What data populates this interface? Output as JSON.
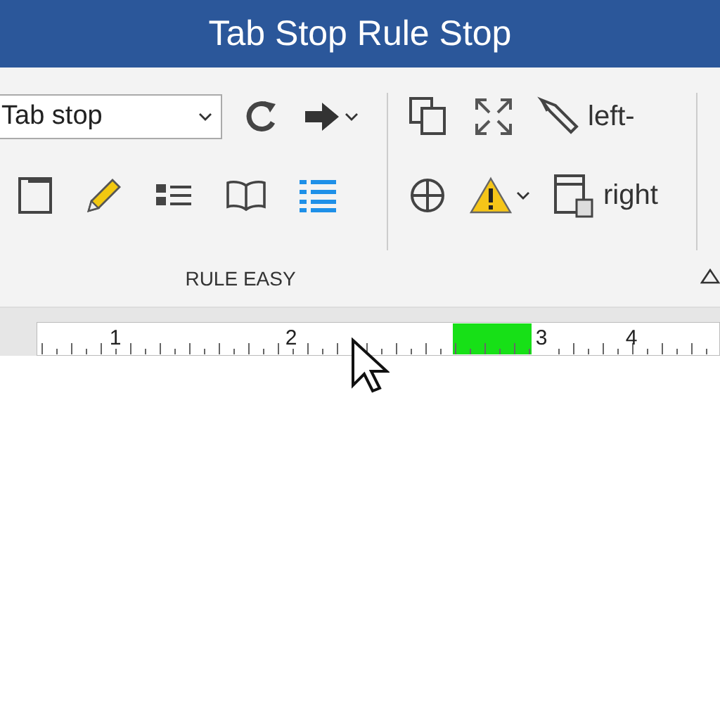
{
  "window": {
    "title": "Tab Stop Rule Stop"
  },
  "ribbon": {
    "dropdown": {
      "value": "Tab stop"
    },
    "left_label": "left-",
    "right_label": "right",
    "group_label": "RULE EASY"
  },
  "ruler": {
    "labels": [
      "1",
      "2",
      "3",
      "4"
    ],
    "highlight": true
  }
}
